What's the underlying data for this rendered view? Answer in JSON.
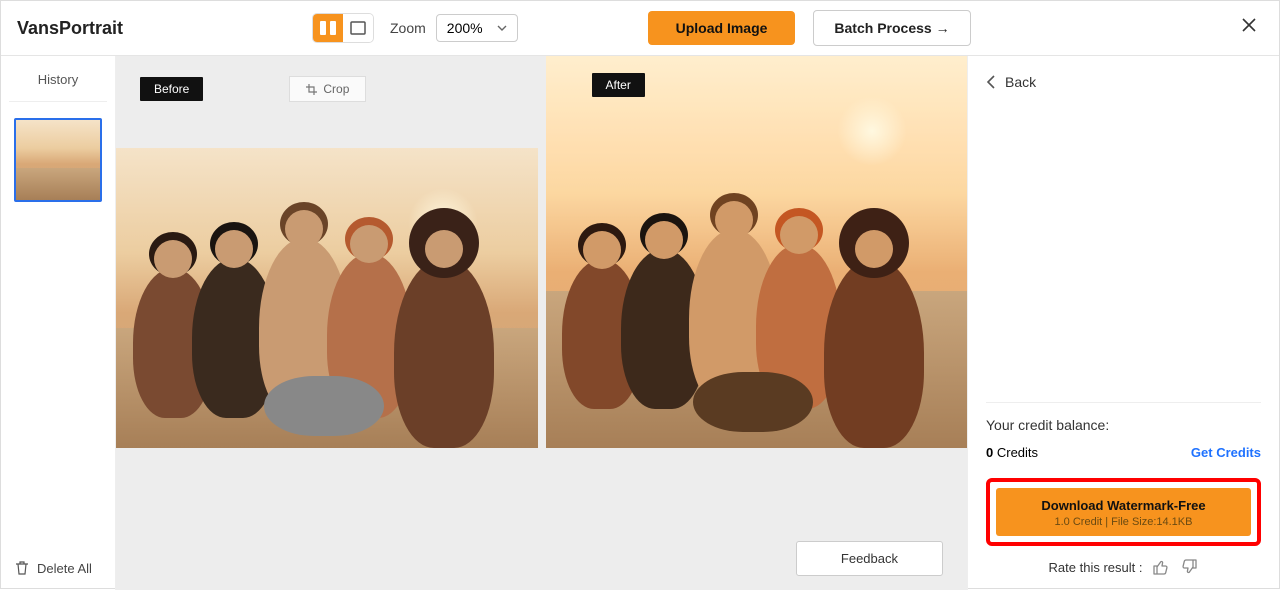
{
  "header": {
    "logo": "VansPortrait",
    "zoom_label": "Zoom",
    "zoom_value": "200%",
    "upload_label": "Upload Image",
    "batch_label": "Batch Process →"
  },
  "left": {
    "history_label": "History",
    "delete_all_label": "Delete All"
  },
  "center": {
    "before_label": "Before",
    "after_label": "After",
    "crop_label": "Crop",
    "feedback_label": "Feedback"
  },
  "right": {
    "back_label": "Back",
    "credit_balance_label": "Your credit balance:",
    "credits_value": "0",
    "credits_suffix": "Credits",
    "get_credits_label": "Get Credits",
    "download_label": "Download Watermark-Free",
    "download_sub": "1.0 Credit | File Size:14.1KB",
    "rate_label": "Rate this result :"
  }
}
